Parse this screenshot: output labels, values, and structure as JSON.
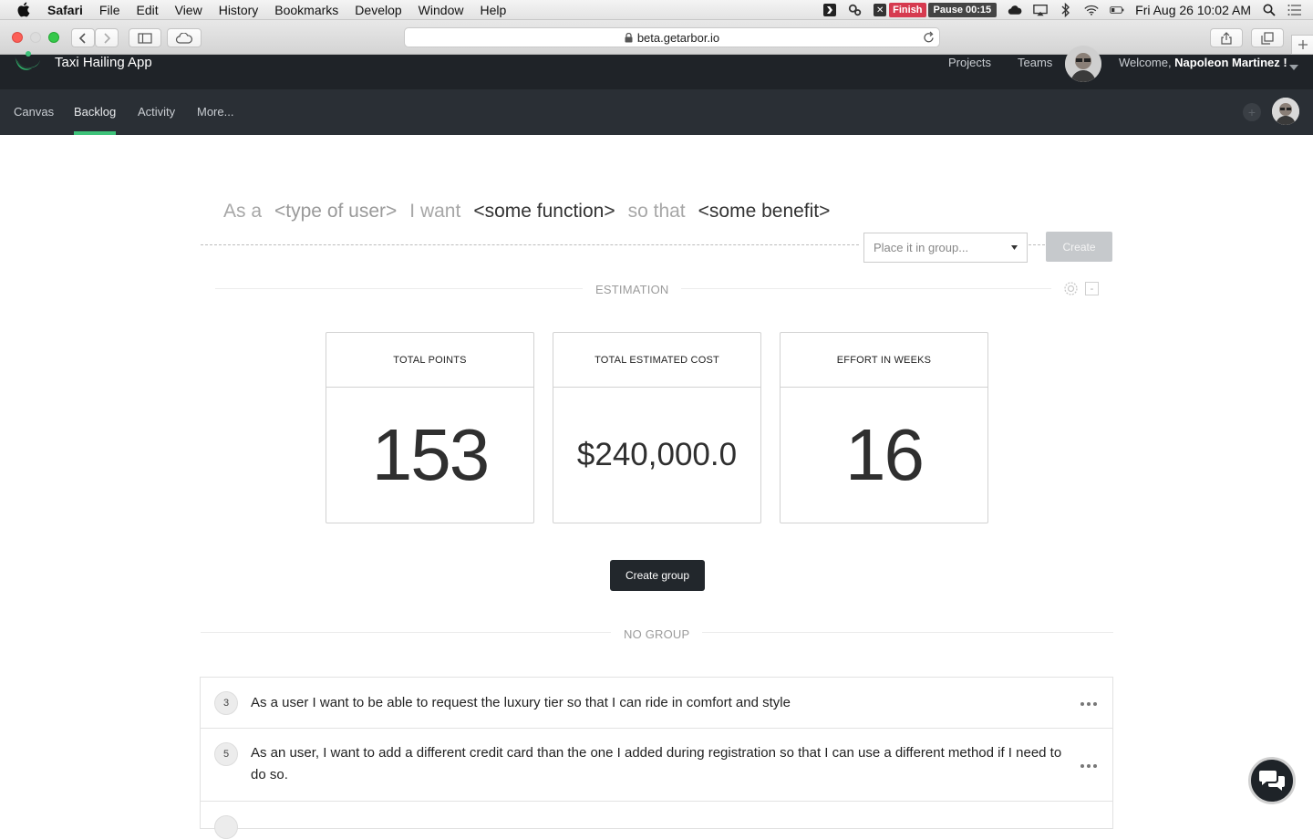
{
  "menubar": {
    "app": "Safari",
    "items": [
      "File",
      "Edit",
      "View",
      "History",
      "Bookmarks",
      "Develop",
      "Window",
      "Help"
    ],
    "finish": "Finish",
    "pause": "Pause 00:15",
    "clock": "Fri Aug 26  10:02 AM"
  },
  "browser": {
    "url": "beta.getarbor.io"
  },
  "header": {
    "app_title": "Taxi Hailing App",
    "projects": "Projects",
    "teams": "Teams",
    "welcome_prefix": "Welcome, ",
    "user_name": "Napoleon Martinez !"
  },
  "nav": {
    "items": [
      "Canvas",
      "Backlog",
      "Activity",
      "More..."
    ],
    "active": "Backlog"
  },
  "composer": {
    "as_a": "As a",
    "type_of_user": "<type of user>",
    "i_want": "I want",
    "some_function": "<some function>",
    "so_that": "so that",
    "some_benefit": "<some benefit>",
    "group_placeholder": "Place it in group...",
    "create_label": "Create"
  },
  "estimation": {
    "title": "ESTIMATION",
    "cards": [
      {
        "label": "TOTAL POINTS",
        "value": "153"
      },
      {
        "label": "TOTAL ESTIMATED COST",
        "value": "$240,000.0"
      },
      {
        "label": "EFFORT IN WEEKS",
        "value": "16"
      }
    ]
  },
  "create_group_label": "Create group",
  "no_group": {
    "title": "NO GROUP",
    "stories": [
      {
        "points": "3",
        "text": "As a user I want to be able to request the luxury tier so that I can ride in comfort and style"
      },
      {
        "points": "5",
        "text": "As an user, I want to add a different credit card than the one I added during registration so that I can use a different method if I need to do so."
      }
    ]
  }
}
